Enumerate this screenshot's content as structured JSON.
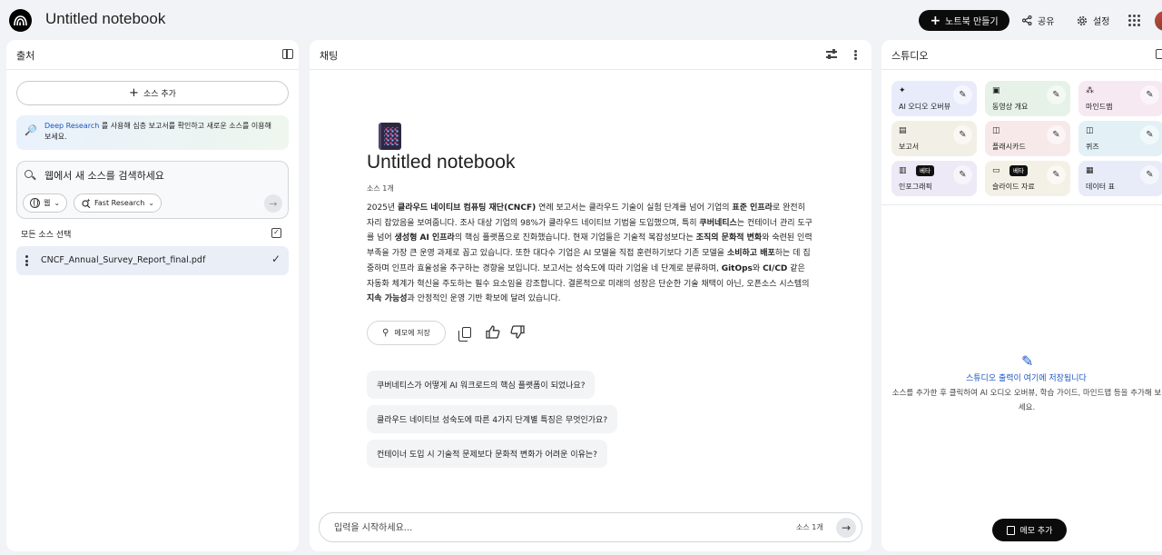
{
  "app": {
    "title": "Untitled notebook"
  },
  "topbar": {
    "create_label": "노트북 만들기",
    "share_label": "공유",
    "settings_label": "설정"
  },
  "sources": {
    "title": "출처",
    "add_label": "소스 추가",
    "deep_research_link": "Deep Research",
    "deep_research_text": " 를 사용해 심층 보고서를 확인하고 새로운 소스를 이용해 보세요.",
    "search_placeholder": "웹에서 새 소스를 검색하세요",
    "chip_web": "웹",
    "chip_fast": "Fast Research",
    "select_all": "모든 소스 선택",
    "files": [
      {
        "name": "CNCF_Annual_Survey_Report_final.pdf"
      }
    ]
  },
  "chat": {
    "title": "채팅",
    "notebook_title": "Untitled notebook",
    "source_count": "소스 1개",
    "summary": [
      {
        "t": "2025년 "
      },
      {
        "t": "클라우드 네이티브 컴퓨팅 재단(CNCF)",
        "b": true
      },
      {
        "t": " 연례 보고서는 클라우드 기술이 실험 단계를 넘어 기업의 "
      },
      {
        "t": "표준 인프라",
        "b": true
      },
      {
        "t": "로 완전히 자리 잡았음을 보여줍니다. 조사 대상 기업의 98%가 클라우드 네이티브 기법을 도입했으며, 특히 "
      },
      {
        "t": "쿠버네티스",
        "b": true
      },
      {
        "t": "는 컨테이너 관리 도구를 넘어 "
      },
      {
        "t": "생성형 AI 인프라",
        "b": true
      },
      {
        "t": "의 핵심 플랫폼으로 진화했습니다. 현재 기업들은 기술적 복잡성보다는 "
      },
      {
        "t": "조직의 문화적 변화",
        "b": true
      },
      {
        "t": "와 숙련된 인력 부족을 가장 큰 운영 과제로 꼽고 있습니다. 또한 대다수 기업은 AI 모델을 직접 훈련하기보다 기존 모델을 "
      },
      {
        "t": "소비하고 배포",
        "b": true
      },
      {
        "t": "하는 데 집중하며 인프라 효율성을 추구하는 경향을 보입니다. 보고서는 성숙도에 따라 기업을 네 단계로 분류하며, "
      },
      {
        "t": "GitOps",
        "b": true
      },
      {
        "t": "와 "
      },
      {
        "t": "CI/CD",
        "b": true
      },
      {
        "t": " 같은 자동화 체계가 혁신을 주도하는 필수 요소임을 강조합니다. 결론적으로 미래의 성장은 단순한 기술 채택이 아닌, 오픈소스 시스템의 "
      },
      {
        "t": "지속 가능성",
        "b": true
      },
      {
        "t": "과 안정적인 운영 기반 확보에 달려 있습니다."
      }
    ],
    "save_note_label": "메모에 저장",
    "suggestions": [
      "쿠버네티스가 어떻게 AI 워크로드의 핵심 플랫폼이 되었나요?",
      "클라우드 네이티브 성숙도에 따른 4가지 단계별 특징은 무엇인가요?",
      "컨테이너 도입 시 기술적 문제보다 문화적 변화가 어려운 이유는?"
    ],
    "input_placeholder": "입력을 시작하세요...",
    "input_source_count": "소스 1개"
  },
  "studio": {
    "title": "스튜디오",
    "tiles": [
      {
        "label": "AI 오디오 오버뷰",
        "icon": "sparkle-audio-icon",
        "color": "#e8ecfa"
      },
      {
        "label": "동영상 개요",
        "icon": "video-icon",
        "color": "#e6f2e7"
      },
      {
        "label": "마인드맵",
        "icon": "mindmap-icon",
        "color": "#f6e9f2"
      },
      {
        "label": "보고서",
        "icon": "report-icon",
        "color": "#f2f0e6"
      },
      {
        "label": "플래시카드",
        "icon": "flashcard-icon",
        "color": "#f7e9e9"
      },
      {
        "label": "퀴즈",
        "icon": "quiz-icon",
        "color": "#e3f1f6"
      },
      {
        "label": "인포그래픽",
        "icon": "infographic-icon",
        "color": "#eee9f6",
        "badge": "베타"
      },
      {
        "label": "슬라이드 자료",
        "icon": "slides-icon",
        "color": "#f3f1e6",
        "badge": "베타"
      },
      {
        "label": "데이터 표",
        "icon": "data-table-icon",
        "color": "#e7ecf8"
      }
    ],
    "empty_title": "스튜디오 출력이 여기에 저장됩니다",
    "empty_desc": "소스를 추가한 후 클릭하여 AI 오디오 오버뷰, 학습 가이드, 마인드맵 등을 추가해 보세요.",
    "add_memo_label": "메모 추가"
  }
}
